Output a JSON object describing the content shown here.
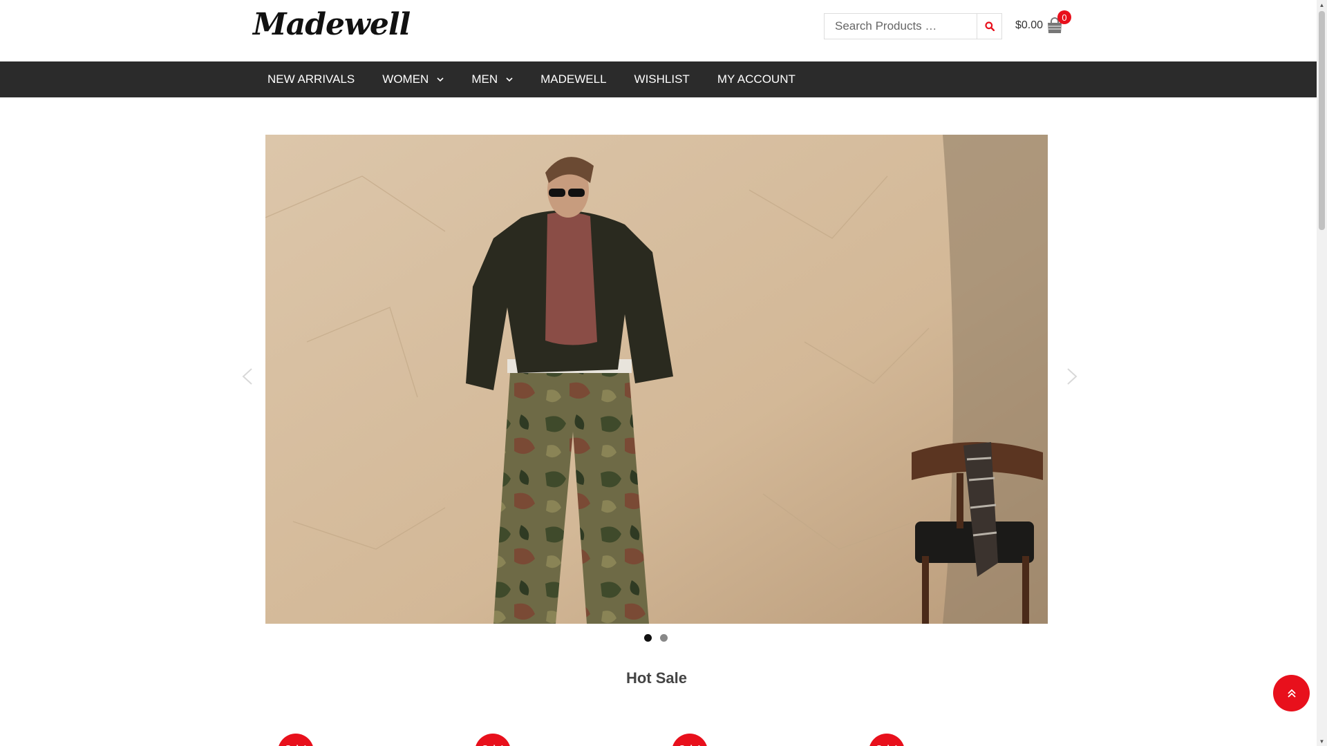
{
  "header": {
    "logo_text": "Madewell",
    "search": {
      "placeholder": "Search Products …",
      "value": ""
    },
    "cart": {
      "amount": "$0.00",
      "count": "0"
    }
  },
  "nav": {
    "items": [
      {
        "label": "NEW ARRIVALS",
        "has_dropdown": false
      },
      {
        "label": "WOMEN",
        "has_dropdown": true
      },
      {
        "label": "MEN",
        "has_dropdown": true
      },
      {
        "label": "MADEWELL",
        "has_dropdown": false
      },
      {
        "label": "WISHLIST",
        "has_dropdown": false
      },
      {
        "label": "MY ACCOUNT",
        "has_dropdown": false
      }
    ]
  },
  "slider": {
    "slide_count": 2,
    "active_slide": 1
  },
  "hot_sale": {
    "title": "Hot Sale",
    "badges": [
      "Sale!",
      "Sale!",
      "Sale!",
      "Sale!"
    ]
  },
  "colors": {
    "accent": "#e8101c",
    "nav_bg": "#2b2b2b",
    "slide_bg": "#d9c1a3"
  },
  "icons": {
    "search": "search-icon",
    "cart": "shopping-bag-icon",
    "back_to_top": "double-chevron-up-icon"
  }
}
